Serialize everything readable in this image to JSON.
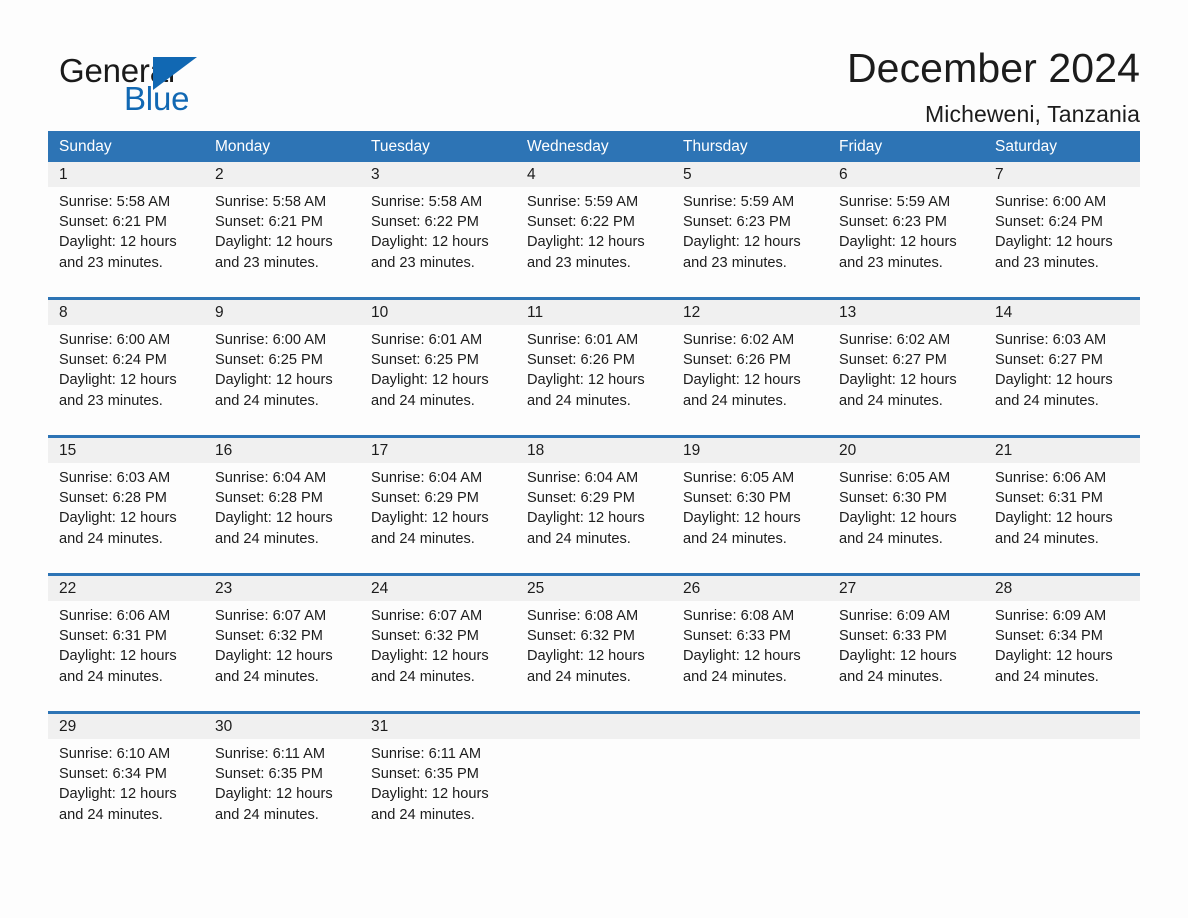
{
  "brand": {
    "name_part1": "General",
    "name_part2": "Blue",
    "accent_color": "#1168b3",
    "triangle_icon": "triangle-icon"
  },
  "header": {
    "month_title": "December 2024",
    "location": "Micheweni, Tanzania"
  },
  "calendar": {
    "header_bg": "#2d74b5",
    "day_band_bg": "#f0f0f0",
    "weekdays": [
      "Sunday",
      "Monday",
      "Tuesday",
      "Wednesday",
      "Thursday",
      "Friday",
      "Saturday"
    ],
    "weeks": [
      [
        {
          "day": "1",
          "info": "Sunrise: 5:58 AM\nSunset: 6:21 PM\nDaylight: 12 hours\nand 23 minutes."
        },
        {
          "day": "2",
          "info": "Sunrise: 5:58 AM\nSunset: 6:21 PM\nDaylight: 12 hours\nand 23 minutes."
        },
        {
          "day": "3",
          "info": "Sunrise: 5:58 AM\nSunset: 6:22 PM\nDaylight: 12 hours\nand 23 minutes."
        },
        {
          "day": "4",
          "info": "Sunrise: 5:59 AM\nSunset: 6:22 PM\nDaylight: 12 hours\nand 23 minutes."
        },
        {
          "day": "5",
          "info": "Sunrise: 5:59 AM\nSunset: 6:23 PM\nDaylight: 12 hours\nand 23 minutes."
        },
        {
          "day": "6",
          "info": "Sunrise: 5:59 AM\nSunset: 6:23 PM\nDaylight: 12 hours\nand 23 minutes."
        },
        {
          "day": "7",
          "info": "Sunrise: 6:00 AM\nSunset: 6:24 PM\nDaylight: 12 hours\nand 23 minutes."
        }
      ],
      [
        {
          "day": "8",
          "info": "Sunrise: 6:00 AM\nSunset: 6:24 PM\nDaylight: 12 hours\nand 23 minutes."
        },
        {
          "day": "9",
          "info": "Sunrise: 6:00 AM\nSunset: 6:25 PM\nDaylight: 12 hours\nand 24 minutes."
        },
        {
          "day": "10",
          "info": "Sunrise: 6:01 AM\nSunset: 6:25 PM\nDaylight: 12 hours\nand 24 minutes."
        },
        {
          "day": "11",
          "info": "Sunrise: 6:01 AM\nSunset: 6:26 PM\nDaylight: 12 hours\nand 24 minutes."
        },
        {
          "day": "12",
          "info": "Sunrise: 6:02 AM\nSunset: 6:26 PM\nDaylight: 12 hours\nand 24 minutes."
        },
        {
          "day": "13",
          "info": "Sunrise: 6:02 AM\nSunset: 6:27 PM\nDaylight: 12 hours\nand 24 minutes."
        },
        {
          "day": "14",
          "info": "Sunrise: 6:03 AM\nSunset: 6:27 PM\nDaylight: 12 hours\nand 24 minutes."
        }
      ],
      [
        {
          "day": "15",
          "info": "Sunrise: 6:03 AM\nSunset: 6:28 PM\nDaylight: 12 hours\nand 24 minutes."
        },
        {
          "day": "16",
          "info": "Sunrise: 6:04 AM\nSunset: 6:28 PM\nDaylight: 12 hours\nand 24 minutes."
        },
        {
          "day": "17",
          "info": "Sunrise: 6:04 AM\nSunset: 6:29 PM\nDaylight: 12 hours\nand 24 minutes."
        },
        {
          "day": "18",
          "info": "Sunrise: 6:04 AM\nSunset: 6:29 PM\nDaylight: 12 hours\nand 24 minutes."
        },
        {
          "day": "19",
          "info": "Sunrise: 6:05 AM\nSunset: 6:30 PM\nDaylight: 12 hours\nand 24 minutes."
        },
        {
          "day": "20",
          "info": "Sunrise: 6:05 AM\nSunset: 6:30 PM\nDaylight: 12 hours\nand 24 minutes."
        },
        {
          "day": "21",
          "info": "Sunrise: 6:06 AM\nSunset: 6:31 PM\nDaylight: 12 hours\nand 24 minutes."
        }
      ],
      [
        {
          "day": "22",
          "info": "Sunrise: 6:06 AM\nSunset: 6:31 PM\nDaylight: 12 hours\nand 24 minutes."
        },
        {
          "day": "23",
          "info": "Sunrise: 6:07 AM\nSunset: 6:32 PM\nDaylight: 12 hours\nand 24 minutes."
        },
        {
          "day": "24",
          "info": "Sunrise: 6:07 AM\nSunset: 6:32 PM\nDaylight: 12 hours\nand 24 minutes."
        },
        {
          "day": "25",
          "info": "Sunrise: 6:08 AM\nSunset: 6:32 PM\nDaylight: 12 hours\nand 24 minutes."
        },
        {
          "day": "26",
          "info": "Sunrise: 6:08 AM\nSunset: 6:33 PM\nDaylight: 12 hours\nand 24 minutes."
        },
        {
          "day": "27",
          "info": "Sunrise: 6:09 AM\nSunset: 6:33 PM\nDaylight: 12 hours\nand 24 minutes."
        },
        {
          "day": "28",
          "info": "Sunrise: 6:09 AM\nSunset: 6:34 PM\nDaylight: 12 hours\nand 24 minutes."
        }
      ],
      [
        {
          "day": "29",
          "info": "Sunrise: 6:10 AM\nSunset: 6:34 PM\nDaylight: 12 hours\nand 24 minutes."
        },
        {
          "day": "30",
          "info": "Sunrise: 6:11 AM\nSunset: 6:35 PM\nDaylight: 12 hours\nand 24 minutes."
        },
        {
          "day": "31",
          "info": "Sunrise: 6:11 AM\nSunset: 6:35 PM\nDaylight: 12 hours\nand 24 minutes."
        },
        {
          "day": "",
          "info": ""
        },
        {
          "day": "",
          "info": ""
        },
        {
          "day": "",
          "info": ""
        },
        {
          "day": "",
          "info": ""
        }
      ]
    ]
  }
}
